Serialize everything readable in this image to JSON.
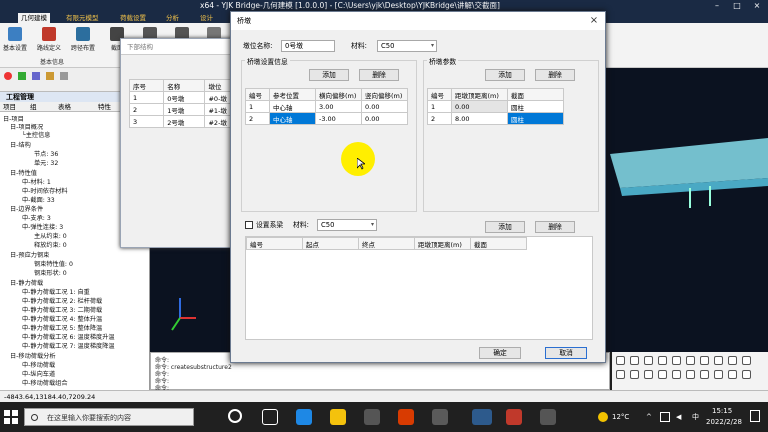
{
  "window": {
    "title": "x64 - YJK Bridge-几何建模 [1.0.0.0] - [C:\\Users\\yjk\\Desktop\\YJKBridge\\讲解\\交截面]",
    "app_tab": "几何建模"
  },
  "ribbon": {
    "tabs": [
      "几何建模",
      "有限元模型",
      "荷载设置",
      "分析",
      "设计"
    ],
    "buttons": [
      "基本设置",
      "路线定义",
      "跨径布置",
      "截面"
    ],
    "group_label": "基本信息"
  },
  "left_panel": {
    "header": "工程管理",
    "tabs": [
      "项目",
      "组",
      "表格",
      "特性"
    ],
    "tree": [
      "日-项目",
      "日-项目概况",
      "└主控信息",
      "日-结构",
      "节点: 36",
      "单元: 32",
      "日-特性值",
      "中-材料: 1",
      "中-时间依存材料",
      "中-截面: 33",
      "日-边界条件",
      "中-支承: 3",
      "中-弹性连接: 3",
      "主从约束: 0",
      "释放约束: 0",
      "日-预应力钢束",
      "钢束特性值: 0",
      "钢束形状: 0",
      "日-静力荷载",
      "中-静力荷载工况 1: 自重",
      "中-静力荷载工况 2: 栏杆荷载",
      "中-静力荷载工况 3: 二期荷载",
      "中-静力荷载工况 4: 整体升温",
      "中-静力荷载工况 5: 整体降温",
      "中-静力荷载工况 6: 温度梯度升温",
      "中-静力荷载工况 7: 温度梯度降温",
      "日-移动荷载分析",
      "中-移动荷载",
      "中-纵向车道",
      "中-移动荷载组合"
    ]
  },
  "background_dialog": {
    "header": "下部结构",
    "columns": [
      "序号",
      "名称",
      "墩位"
    ],
    "rows": [
      [
        "1",
        "0号墩",
        "#0-墩"
      ],
      [
        "2",
        "1号墩",
        "#1-墩"
      ],
      [
        "3",
        "2号墩",
        "#2-墩"
      ]
    ]
  },
  "dialog": {
    "title": "桥墩",
    "pier_name_label": "墩位名称:",
    "pier_name_value": "0号墩",
    "material_label": "材料:",
    "material_value": "C50",
    "layout_group": "桥墩设置信息",
    "params_group": "桥墩参数",
    "add_label": "添加",
    "delete_label": "删除",
    "layout_columns": [
      "编号",
      "参考位置",
      "横向偏移(m)",
      "竖向偏移(m)"
    ],
    "layout_rows": [
      [
        "1",
        "中心轴",
        "3.00",
        "0.00"
      ],
      [
        "2",
        "中心轴",
        "-3.00",
        "0.00"
      ]
    ],
    "param_columns": [
      "编号",
      "距墩顶距离(m)",
      "截面"
    ],
    "param_rows": [
      [
        "1",
        "0.00",
        "圆柱"
      ],
      [
        "2",
        "8.00",
        "圆柱"
      ]
    ],
    "tie_beam_label": "设置系梁",
    "tie_material_label": "材料:",
    "tie_material_value": "C50",
    "tie_columns": [
      "编号",
      "起点",
      "终点",
      "距墩顶距离(m)",
      "截面"
    ],
    "ok_label": "确定",
    "cancel_label": "取消"
  },
  "command": {
    "lines": [
      "命令:",
      "命令: createsubstructure2",
      "命令:",
      "命令:",
      "命令:"
    ]
  },
  "statusbar": {
    "coords": "-4843.64,13184.40,7209.24"
  },
  "taskbar": {
    "search_placeholder": "在这里输入你要搜索的内容",
    "temperature": "12°C",
    "ime": "中",
    "time": "15:15",
    "date": "2022/2/28"
  }
}
